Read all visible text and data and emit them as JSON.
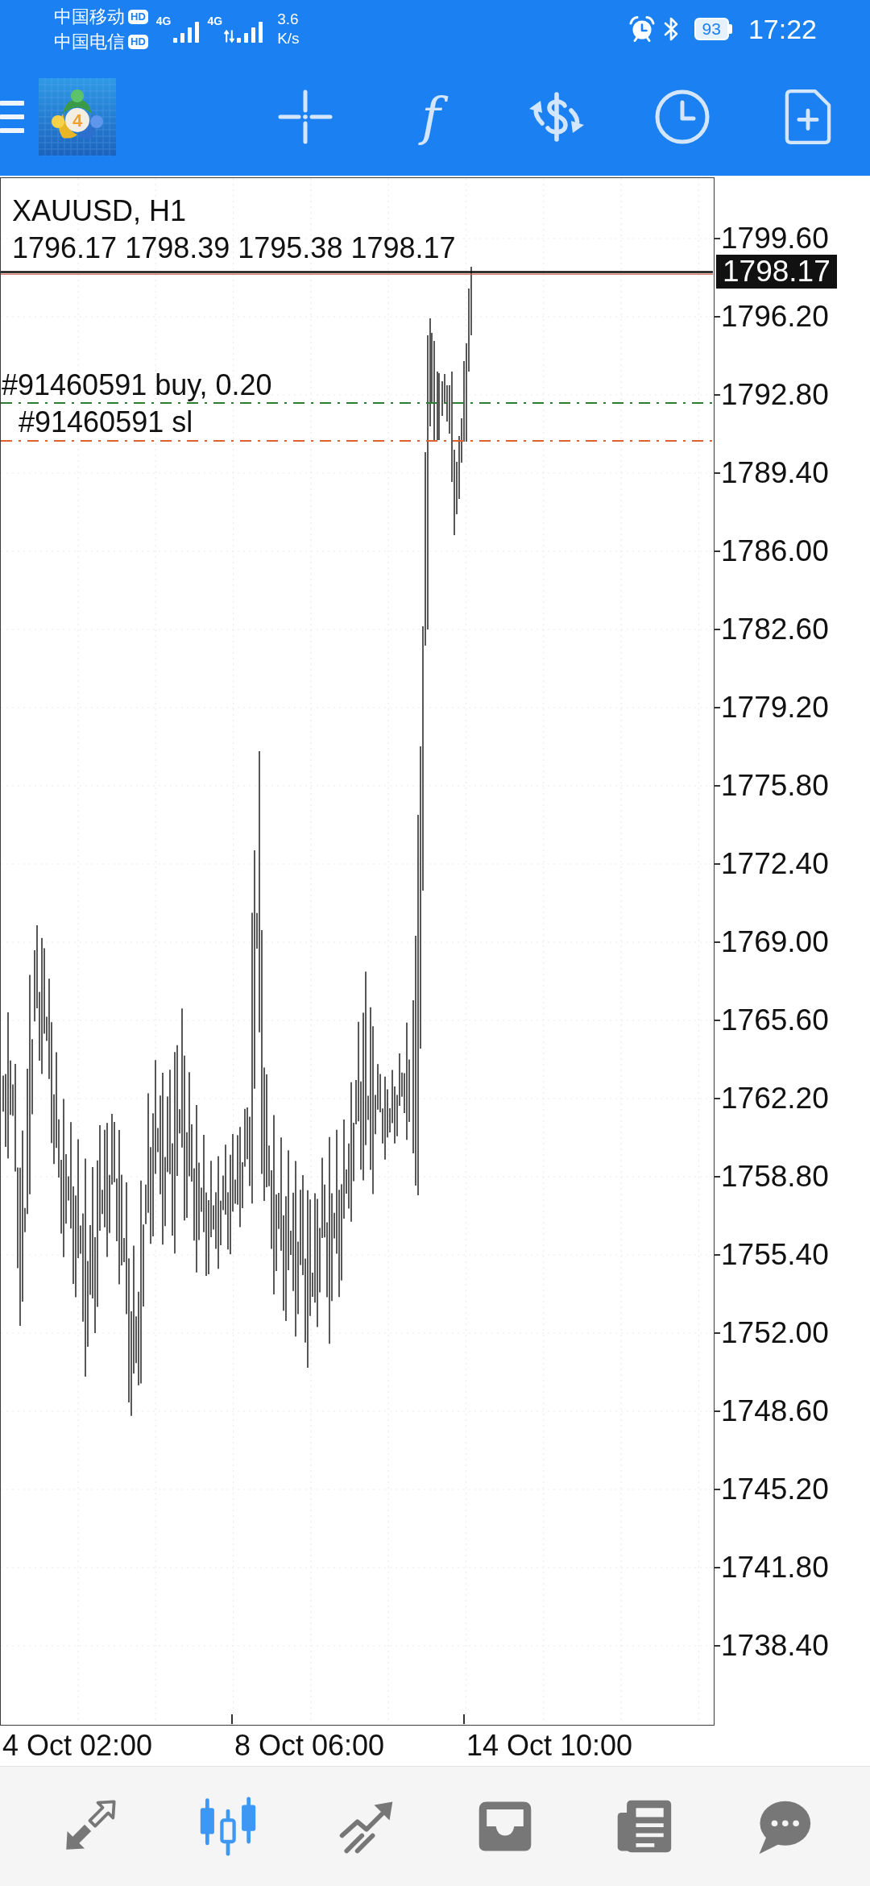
{
  "status_bar": {
    "carriers": [
      {
        "name": "中国移动",
        "badge": "HD"
      },
      {
        "name": "中国电信",
        "badge": "HD"
      }
    ],
    "networks": [
      {
        "type": "4G",
        "data_active": false
      },
      {
        "type": "4G",
        "data_active": true
      }
    ],
    "speed": {
      "value": "3.6",
      "unit": "K/s"
    },
    "battery": "93",
    "time": "17:22"
  },
  "toolbar": {
    "logo_badge": "4",
    "buttons": [
      {
        "kind": "crosshair"
      },
      {
        "kind": "function",
        "label": "f"
      },
      {
        "kind": "currency"
      },
      {
        "kind": "clock"
      },
      {
        "kind": "new_document"
      }
    ]
  },
  "chart": {
    "symbol": "XAUUSD, H1",
    "ohlc": "1796.17 1798.39 1795.38 1798.17",
    "current_price": "1798.17",
    "orders": [
      {
        "label": "#91460591 buy, 0.20",
        "color": "#2e7d32"
      },
      {
        "label": "#91460591 sl",
        "color": "#e0602f"
      }
    ],
    "price_axis": [
      "1799.60",
      "1796.20",
      "1792.80",
      "1789.40",
      "1786.00",
      "1782.60",
      "1779.20",
      "1775.80",
      "1772.40",
      "1769.00",
      "1765.60",
      "1762.20",
      "1758.80",
      "1755.40",
      "1752.00",
      "1748.60",
      "1745.20",
      "1741.80",
      "1738.40"
    ],
    "time_axis": [
      "4 Oct 02:00",
      "8 Oct 06:00",
      "14 Oct 10:00"
    ]
  },
  "bottom_nav": [
    {
      "kind": "quotes",
      "selected": false
    },
    {
      "kind": "chart",
      "selected": true
    },
    {
      "kind": "trade",
      "selected": false
    },
    {
      "kind": "history",
      "selected": false
    },
    {
      "kind": "news",
      "selected": false
    },
    {
      "kind": "messages",
      "selected": false
    }
  ]
}
